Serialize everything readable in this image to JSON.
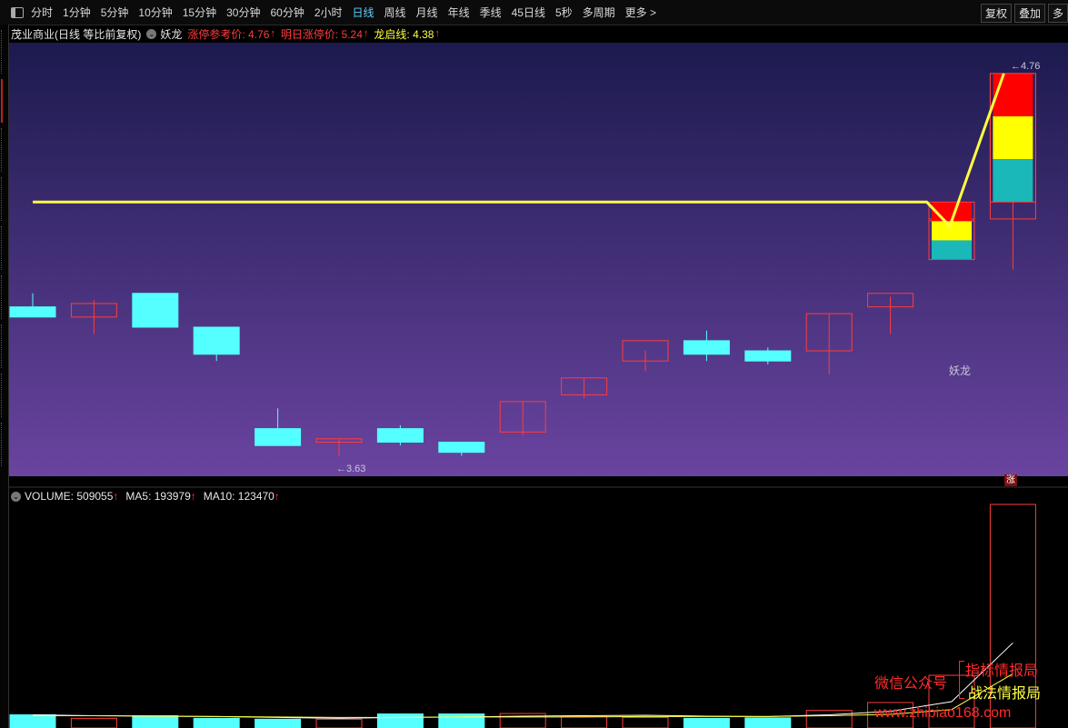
{
  "toolbar": {
    "periods": [
      "分时",
      "1分钟",
      "5分钟",
      "10分钟",
      "15分钟",
      "30分钟",
      "60分钟",
      "2小时",
      "日线",
      "周线",
      "月线",
      "年线",
      "季线",
      "45日线",
      "5秒",
      "多周期",
      "更多 >"
    ],
    "active_period": "日线",
    "right_buttons": [
      "复权",
      "叠加",
      "多"
    ]
  },
  "header": {
    "stock_title": "茂业商业(日线 等比前复权)",
    "indicator_name": "妖龙",
    "ref_label": "涨停参考价: 4.76",
    "next_label": "明日涨停价: 5.24",
    "start_label": "龙启线: 4.38",
    "up_arrow": "↑"
  },
  "volume_header": {
    "volume_label": "VOLUME: 509055",
    "ma5_label": "MA5: 193979",
    "ma10_label": "MA10: 123470",
    "up_arrow": "↑"
  },
  "annotations": {
    "low_marker": "←3.63",
    "high_marker": "←4.76",
    "signal_label": "妖龙",
    "zhang_badge": "涨"
  },
  "watermark": {
    "wechat": "微信公众号",
    "name1": "指标情报局",
    "name2": "战法情报局",
    "url": "www.zhibiao168.com"
  },
  "colors": {
    "up": "#ff3c3c",
    "down": "#54ffff",
    "ma_line": "#ffff40",
    "zone_red": "#ff0000",
    "zone_yellow": "#ffff00",
    "zone_teal": "#1ab8b8"
  },
  "chart_data": {
    "type": "candlestick",
    "price_range": [
      3.58,
      4.8
    ],
    "candles": [
      {
        "o": 4.07,
        "h": 4.11,
        "l": 4.05,
        "c": 4.04
      },
      {
        "o": 4.04,
        "h": 4.09,
        "l": 3.99,
        "c": 4.08
      },
      {
        "o": 4.11,
        "h": 4.11,
        "l": 4.01,
        "c": 4.01
      },
      {
        "o": 4.01,
        "h": 4.01,
        "l": 3.91,
        "c": 3.93
      },
      {
        "o": 3.71,
        "h": 3.77,
        "l": 3.66,
        "c": 3.66
      },
      {
        "o": 3.67,
        "h": 3.68,
        "l": 3.63,
        "c": 3.68
      },
      {
        "o": 3.71,
        "h": 3.72,
        "l": 3.66,
        "c": 3.67
      },
      {
        "o": 3.67,
        "h": 3.67,
        "l": 3.63,
        "c": 3.64
      },
      {
        "o": 3.7,
        "h": 3.79,
        "l": 3.69,
        "c": 3.79
      },
      {
        "o": 3.81,
        "h": 3.86,
        "l": 3.8,
        "c": 3.86
      },
      {
        "o": 3.91,
        "h": 3.94,
        "l": 3.88,
        "c": 3.97
      },
      {
        "o": 3.97,
        "h": 4.0,
        "l": 3.91,
        "c": 3.93
      },
      {
        "o": 3.94,
        "h": 3.95,
        "l": 3.9,
        "c": 3.91
      },
      {
        "o": 3.94,
        "h": 4.05,
        "l": 3.87,
        "c": 4.05
      },
      {
        "o": 4.07,
        "h": 4.1,
        "l": 3.99,
        "c": 4.11
      },
      {
        "o": 4.33,
        "h": 4.34,
        "l": 4.21,
        "c": 4.33
      },
      {
        "o": 4.33,
        "h": 4.76,
        "l": 4.18,
        "c": 4.76
      }
    ],
    "dragon_line": [
      4.38,
      4.38,
      4.38,
      4.38,
      4.38,
      4.38,
      4.38,
      4.38,
      4.38,
      4.38,
      4.38,
      4.38,
      4.38,
      4.38,
      4.38,
      4.33,
      4.76
    ],
    "zones": [
      {
        "index": 15,
        "top": 4.38,
        "bottom": 4.21
      },
      {
        "index": 16,
        "top": 4.76,
        "bottom": 4.38
      }
    ],
    "volume": [
      30000,
      22000,
      28000,
      22000,
      20000,
      20000,
      32000,
      32000,
      33000,
      26000,
      24000,
      22000,
      23000,
      40000,
      58000,
      120000,
      509055
    ],
    "volume_up": [
      false,
      true,
      false,
      false,
      false,
      true,
      false,
      false,
      true,
      true,
      true,
      false,
      false,
      true,
      true,
      true,
      true
    ],
    "ma5": [
      30000,
      28000,
      27000,
      26000,
      24000,
      22000,
      24000,
      25000,
      27000,
      28000,
      29000,
      27000,
      26000,
      30000,
      38000,
      60000,
      193979
    ],
    "ma10": [
      28000,
      28000,
      27000,
      26000,
      25000,
      24000,
      24000,
      25000,
      25000,
      25000,
      26000,
      26000,
      26000,
      28000,
      31000,
      42000,
      123470
    ]
  }
}
